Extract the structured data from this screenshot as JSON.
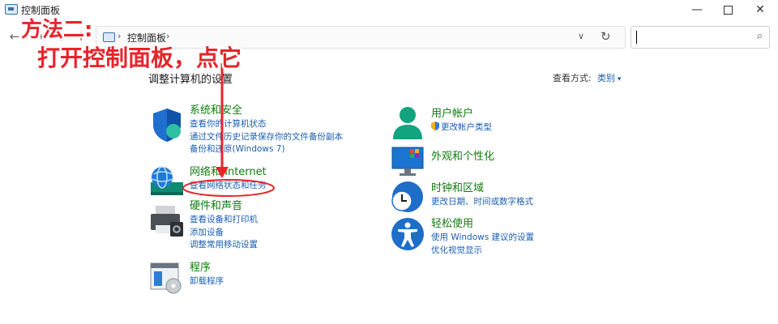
{
  "window": {
    "title": "控制面板",
    "minimize_glyph": "—",
    "close_glyph": "✕"
  },
  "nav": {
    "back_glyph": "←",
    "forward_glyph": "→",
    "history_glyph": "∨",
    "up_glyph": "↑"
  },
  "address": {
    "separator": "›",
    "crumb": "控制面板",
    "dropdown_glyph": "∨",
    "refresh_glyph": "↻"
  },
  "search": {
    "icon_glyph": "⌕"
  },
  "annotation": {
    "line1": "方法二:",
    "line2": "打开控制面板，点它",
    "color": "#e8242b"
  },
  "main": {
    "title": "调整计算机的设置",
    "view_by_label": "查看方式:",
    "view_by_value": "类别"
  },
  "categories_left": [
    {
      "icon": "shield-icon",
      "title": "系统和安全",
      "links": [
        "查看你的计算机状态",
        "通过文件历史记录保存你的文件备份副本",
        "备份和还原(Windows 7)"
      ]
    },
    {
      "icon": "globe-network-icon",
      "title": "网络和 Internet",
      "links": [
        "查看网络状态和任务"
      ]
    },
    {
      "icon": "printer-icon",
      "title": "硬件和声音",
      "links": [
        "查看设备和打印机",
        "添加设备",
        "调整常用移动设置"
      ]
    },
    {
      "icon": "programs-icon",
      "title": "程序",
      "links": [
        "卸载程序"
      ]
    }
  ],
  "categories_right": [
    {
      "icon": "user-icon",
      "title": "用户帐户",
      "links": [
        "更改帐户类型"
      ]
    },
    {
      "icon": "monitor-icon",
      "title": "外观和个性化",
      "links": []
    },
    {
      "icon": "clock-globe-icon",
      "title": "时钟和区域",
      "links": [
        "更改日期、时间或数字格式"
      ]
    },
    {
      "icon": "accessibility-icon",
      "title": "轻松使用",
      "links": [
        "使用 Windows 建议的设置",
        "优化视觉显示"
      ]
    }
  ],
  "colors": {
    "category_title": "#107c10",
    "link": "#1a5fb4",
    "annotation": "#e8242b"
  }
}
